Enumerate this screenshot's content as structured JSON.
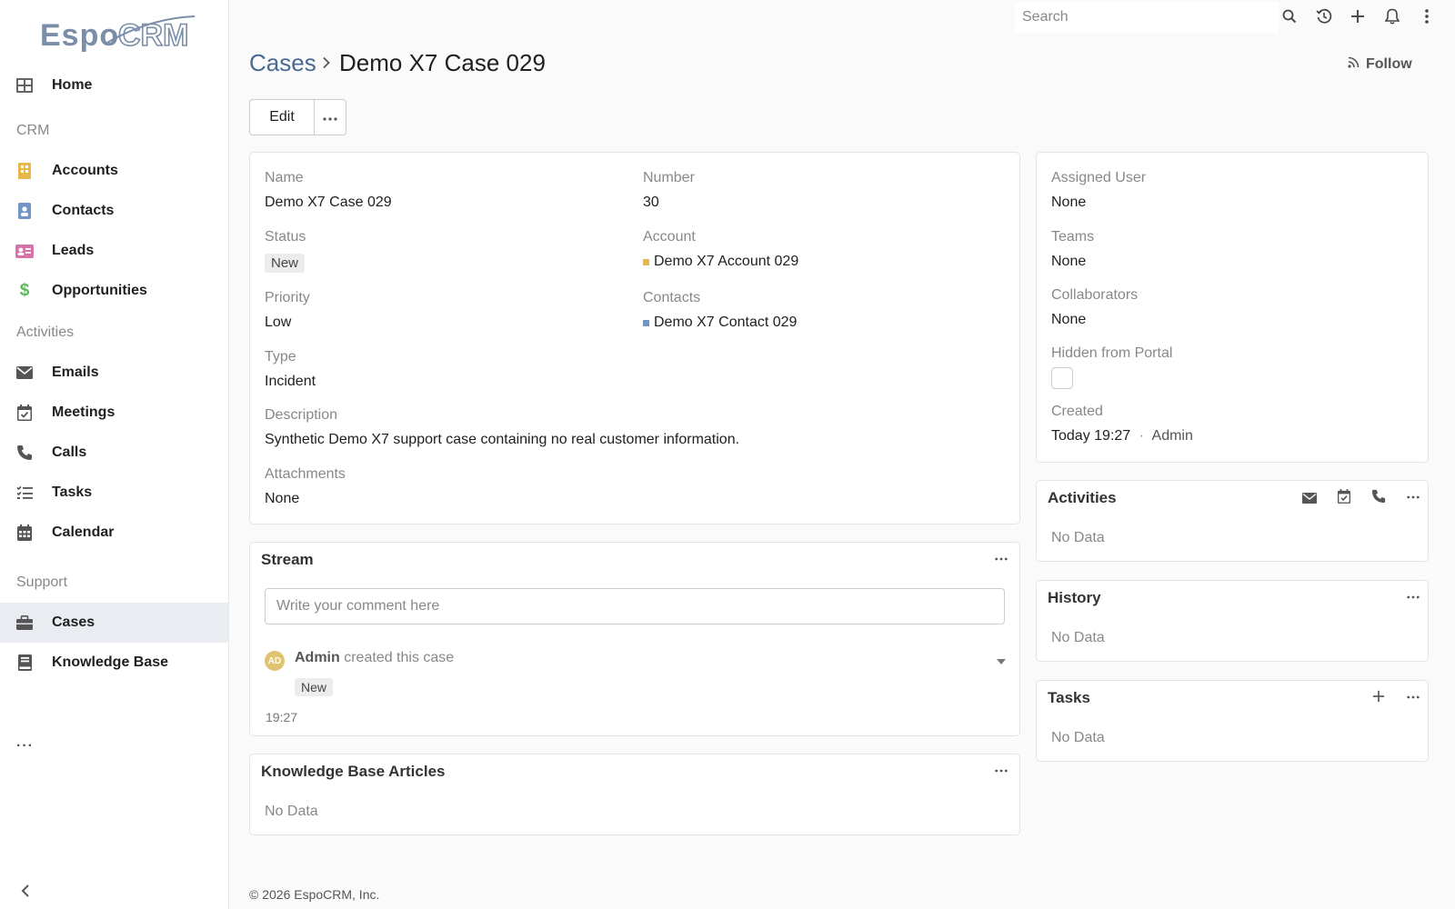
{
  "app": {
    "logo_text": "EspoCRM",
    "accent": "#4a6a93"
  },
  "search": {
    "placeholder": "Search"
  },
  "topbar": {
    "icons": [
      "search-icon",
      "history-icon",
      "plus-icon",
      "bell-icon",
      "kebab-icon"
    ]
  },
  "sidebar": {
    "home": "Home",
    "group_crm": "CRM",
    "accounts": "Accounts",
    "contacts": "Contacts",
    "leads": "Leads",
    "opportunities": "Opportunities",
    "group_activities": "Activities",
    "emails": "Emails",
    "meetings": "Meetings",
    "calls": "Calls",
    "tasks": "Tasks",
    "calendar": "Calendar",
    "group_support": "Support",
    "cases": "Cases",
    "knowledge_base": "Knowledge Base",
    "more": "···",
    "active": "cases"
  },
  "header": {
    "parent": "Cases",
    "current": "Demo X7 Case 029",
    "follow_label": "Follow"
  },
  "actions": {
    "edit_label": "Edit"
  },
  "detail": {
    "name_label": "Name",
    "name_value": "Demo X7 Case 029",
    "number_label": "Number",
    "number_value": "30",
    "status_label": "Status",
    "status_value": "New",
    "account_label": "Account",
    "account_value": "Demo X7 Account 029",
    "priority_label": "Priority",
    "priority_value": "Low",
    "contacts_label": "Contacts",
    "contacts_value": "Demo X7 Contact 029",
    "type_label": "Type",
    "type_value": "Incident",
    "description_label": "Description",
    "description_value": "Synthetic Demo X7 support case containing no real customer information.",
    "attachments_label": "Attachments",
    "attachments_value": "None"
  },
  "side": {
    "assigned_label": "Assigned User",
    "assigned_value": "None",
    "teams_label": "Teams",
    "teams_value": "None",
    "collab_label": "Collaborators",
    "collab_value": "None",
    "hidden_label": "Hidden from Portal",
    "created_label": "Created",
    "created_value": "Today 19:27",
    "created_sep": "·",
    "created_by": "Admin"
  },
  "stream": {
    "title": "Stream",
    "comment_placeholder": "Write your comment here",
    "note_avatar": "AD",
    "note_user": "Admin",
    "note_action": " created this case",
    "note_badge": "New",
    "note_time": "19:27"
  },
  "kb": {
    "title": "Knowledge Base Articles",
    "nodata": "No Data"
  },
  "activities": {
    "title": "Activities",
    "nodata": "No Data"
  },
  "history": {
    "title": "History",
    "nodata": "No Data"
  },
  "tasks_panel": {
    "title": "Tasks",
    "nodata": "No Data"
  },
  "footer": {
    "text": "© 2026 EspoCRM, Inc."
  },
  "colors": {
    "accounts_icon": "#e6b84a",
    "contacts_icon": "#6f95c9",
    "leads_icon": "#d672a7",
    "opportunities_icon": "#5cb85c",
    "account_square": "#e6b84a",
    "contact_square": "#6f95c9"
  }
}
